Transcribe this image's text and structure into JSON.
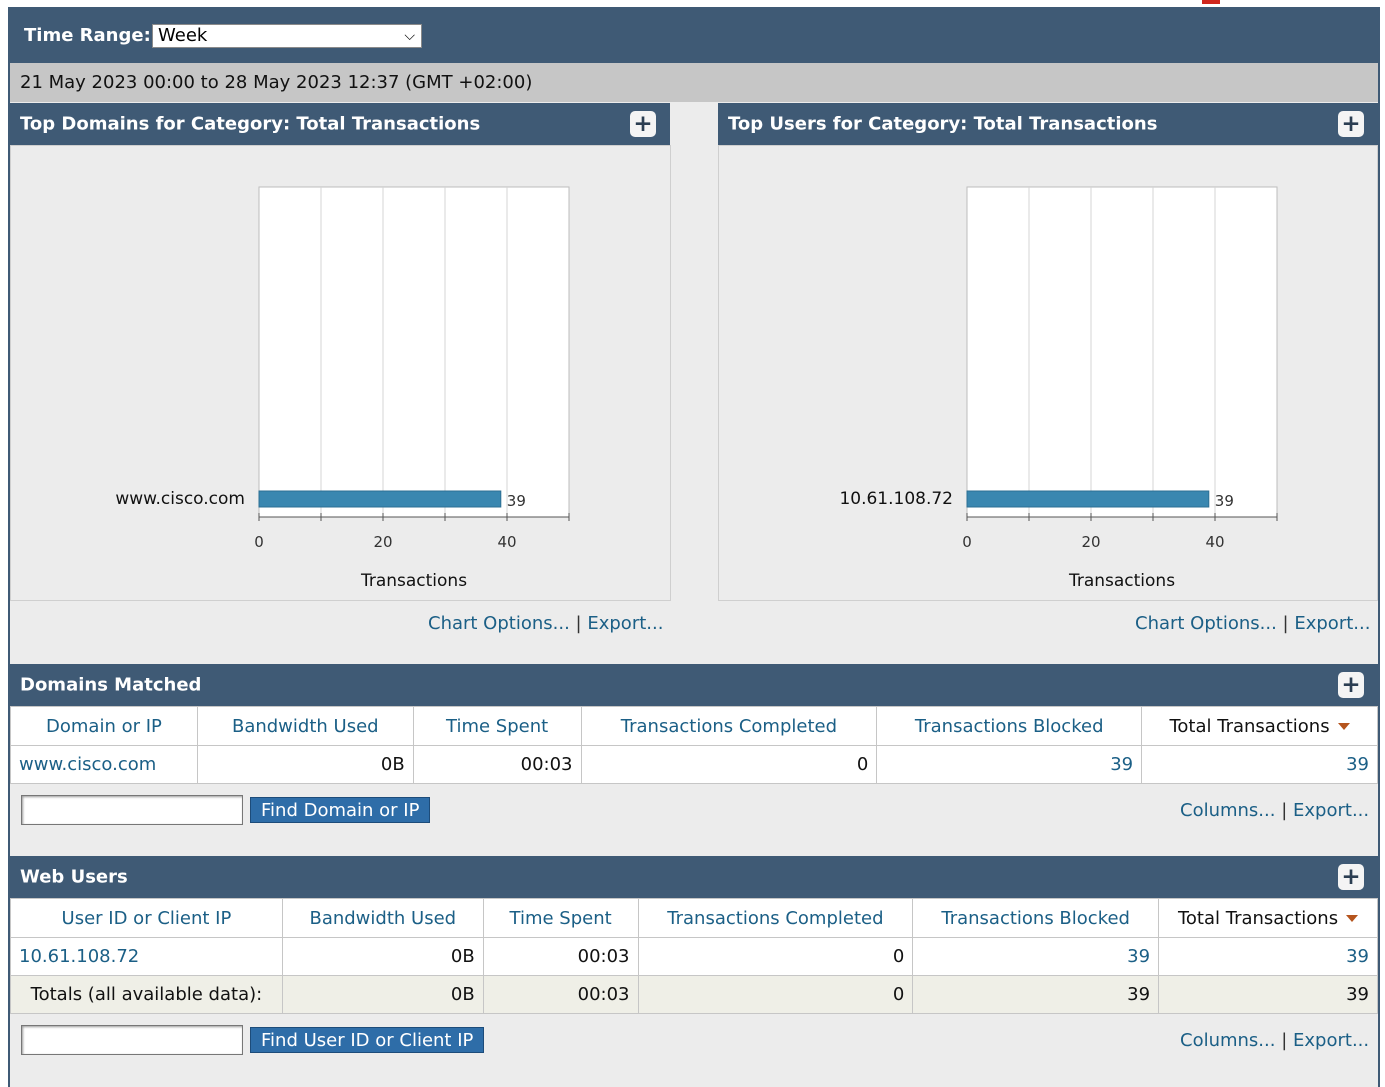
{
  "time_range": {
    "label": "Time Range:",
    "selected": "Week"
  },
  "date_range": "21 May 2023 00:00 to 28 May 2023 12:37 (GMT +02:00)",
  "charts": {
    "domains": {
      "title": "Top Domains for Category: Total Transactions",
      "footer": {
        "chart_options": "Chart Options...",
        "sep": "|",
        "export": "Export..."
      }
    },
    "users": {
      "title": "Top Users for Category: Total Transactions",
      "footer": {
        "chart_options": "Chart Options...",
        "sep": "|",
        "export": "Export..."
      }
    }
  },
  "chart_data": [
    {
      "type": "bar",
      "orientation": "horizontal",
      "title": "Top Domains for Category: Total Transactions",
      "categories": [
        "www.cisco.com"
      ],
      "values": [
        39
      ],
      "data_labels": [
        "39"
      ],
      "xlabel": "Transactions",
      "ylabel": "",
      "xlim": [
        0,
        50
      ],
      "xticks": [
        0,
        20,
        40
      ],
      "grid": true,
      "color": "#3a87b0"
    },
    {
      "type": "bar",
      "orientation": "horizontal",
      "title": "Top Users for Category: Total Transactions",
      "categories": [
        "10.61.108.72"
      ],
      "values": [
        39
      ],
      "data_labels": [
        "39"
      ],
      "xlabel": "Transactions",
      "ylabel": "",
      "xlim": [
        0,
        50
      ],
      "xticks": [
        0,
        20,
        40
      ],
      "grid": true,
      "color": "#3a87b0"
    }
  ],
  "domains_matched": {
    "title": "Domains Matched",
    "columns": [
      "Domain or IP",
      "Bandwidth Used",
      "Time Spent",
      "Transactions Completed",
      "Transactions Blocked",
      "Total Transactions"
    ],
    "rows": [
      [
        "www.cisco.com",
        "0B",
        "00:03",
        "0",
        "39",
        "39"
      ]
    ],
    "find_button": "Find Domain or IP",
    "footer": {
      "columns": "Columns...",
      "sep": "|",
      "export": "Export..."
    }
  },
  "web_users": {
    "title": "Web Users",
    "columns": [
      "User ID or Client IP",
      "Bandwidth Used",
      "Time Spent",
      "Transactions Completed",
      "Transactions Blocked",
      "Total Transactions"
    ],
    "rows": [
      [
        "10.61.108.72",
        "0B",
        "00:03",
        "0",
        "39",
        "39"
      ]
    ],
    "totals": [
      "Totals (all available data):",
      "0B",
      "00:03",
      "0",
      "39",
      "39"
    ],
    "find_button": "Find User ID or Client  IP",
    "footer": {
      "columns": "Columns...",
      "sep": "|",
      "export": "Export..."
    }
  },
  "colors": {
    "header": "#3f5a75",
    "link": "#1b5f86",
    "bar": "#3a87b0",
    "button": "#2e6da8"
  }
}
